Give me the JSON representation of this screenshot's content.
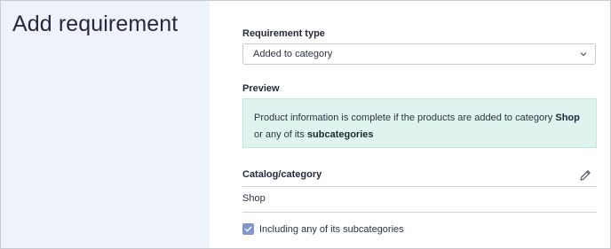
{
  "page": {
    "title": "Add requirement"
  },
  "requirement_type": {
    "label": "Requirement type",
    "selected": "Added to category",
    "icon": "chevron-down-icon"
  },
  "preview": {
    "label": "Preview",
    "text_before": "Product information is complete if the products are added to category ",
    "category": "Shop",
    "text_middle": " or any of its ",
    "subcategories": "subcategories"
  },
  "catalog": {
    "label": "Catalog/category",
    "value": "Shop",
    "edit_icon": "pencil-icon"
  },
  "include_subcategories": {
    "label": "Including any of its subcategories",
    "checked": true
  },
  "colors": {
    "left_pane_bg": "#eef2fb",
    "preview_bg": "#dff4ee",
    "checkbox": "#7f98c9"
  }
}
